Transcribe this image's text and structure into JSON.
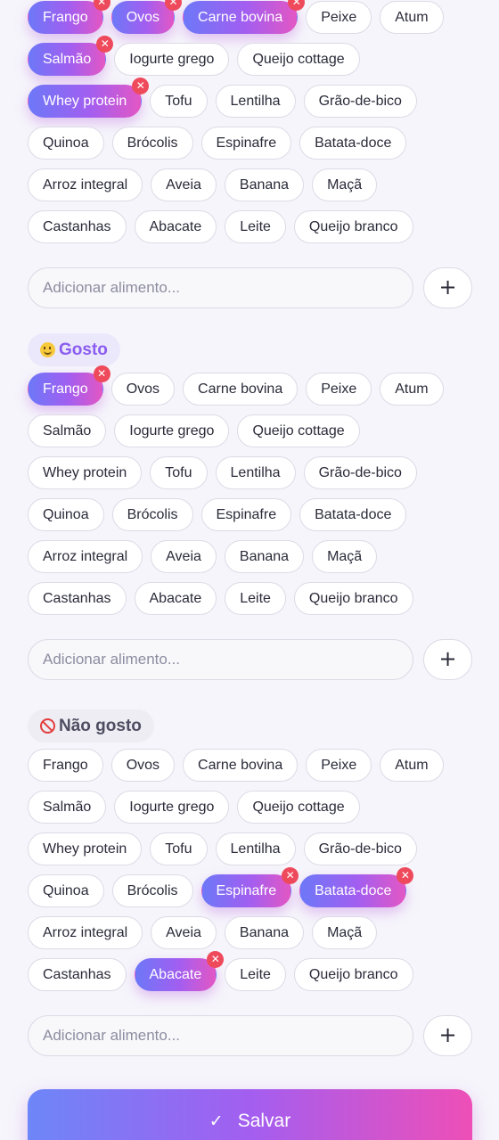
{
  "foods": [
    "Frango",
    "Ovos",
    "Carne bovina",
    "Peixe",
    "Atum",
    "Salmão",
    "Iogurte grego",
    "Queijo cottage",
    "Whey protein",
    "Tofu",
    "Lentilha",
    "Grão-de-bico",
    "Quinoa",
    "Brócolis",
    "Espinafre",
    "Batata-doce",
    "Arroz integral",
    "Aveia",
    "Banana",
    "Maçã",
    "Castanhas",
    "Abacate",
    "Leite",
    "Queijo branco"
  ],
  "remove_symbol": "✕",
  "sections": [
    {
      "selected": [
        0,
        1,
        2,
        5,
        8
      ],
      "add_placeholder": "Adicionar alimento...",
      "add_label": "+"
    },
    {
      "title": "Gosto",
      "icon": "smile-emoji-icon",
      "selected": [
        0
      ],
      "add_placeholder": "Adicionar alimento...",
      "add_label": "+"
    },
    {
      "title": "Não gosto",
      "icon": "prohibited-icon",
      "selected": [
        14,
        15,
        21
      ],
      "add_placeholder": "Adicionar alimento...",
      "add_label": "+"
    }
  ],
  "save": {
    "label": "Salvar",
    "icon": "check-icon",
    "icon_glyph": "✓"
  },
  "colors": {
    "selected_gradient_start": "#6d78f8",
    "selected_gradient_end": "#e357c4",
    "remove_badge": "#ee4a5c",
    "like_text": "#8a5cf0"
  }
}
